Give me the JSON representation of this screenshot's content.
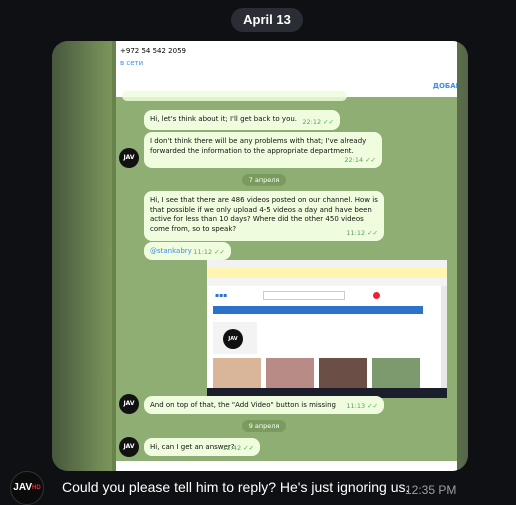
{
  "date_header": "April 13",
  "inner": {
    "contact_phone": "+972 54 542 2059",
    "contact_status": "в сети",
    "add_button": "ДОБАВ",
    "messages": [
      {
        "text": "Hi, let's think about it; I'll get back to you.",
        "time": "22:12"
      },
      {
        "text": "I don't think there will be any problems with that; I've already forwarded the information to the appropriate department.",
        "time": "22:14"
      },
      {
        "text": "Hi, I see that there are 486 videos posted on our channel. How is that possible if we only upload 4-5 videos a day and have been active for less than 10 days? Where did the other 450 videos come from, so to speak?",
        "time": "11:12"
      },
      {
        "text": "@stankabry",
        "time": "11:12"
      },
      {
        "text": "And on top of that, the \"Add Video\" button is missing",
        "time": "11:13"
      },
      {
        "text": "Hi, can I get an answer?",
        "time": "12:42"
      }
    ],
    "date_dividers": [
      "7 апреля",
      "9 апреля"
    ],
    "avatar_label": "JAV"
  },
  "reply": {
    "avatar_label": "JAV",
    "avatar_badge": "HD",
    "text": "Could you please tell him to reply? He's just ignoring us.",
    "time": "12:35 PM"
  },
  "colors": {
    "background": "#0e1014",
    "inner_chat_bg": "#8fae73",
    "bubble": "#effdde",
    "check": "#4fae4e",
    "link": "#3a8ee6"
  },
  "icons": [
    "double-check-icon",
    "avatar-icon"
  ]
}
